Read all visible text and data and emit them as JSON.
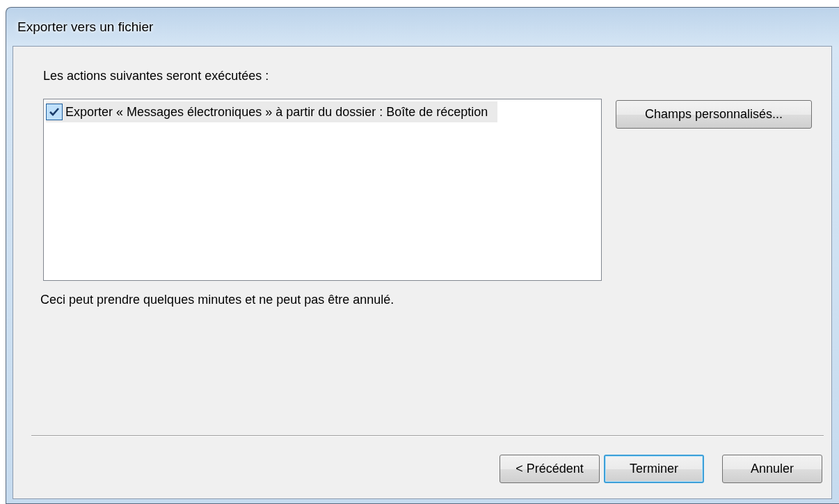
{
  "window": {
    "title": "Exporter vers un fichier"
  },
  "heading": "Les actions suivantes seront exécutées :",
  "actions": [
    {
      "label": "Exporter « Messages électroniques » à partir du dossier : Boîte de réception",
      "checked": true,
      "selected": true
    }
  ],
  "side_button": "Champs personnalisés...",
  "note": "Ceci peut prendre quelques minutes et ne peut pas être annulé.",
  "buttons": [
    {
      "label": "< Précédent",
      "default": false
    },
    {
      "label": "Terminer",
      "default": true
    },
    {
      "label": "Annuler",
      "default": false
    }
  ]
}
